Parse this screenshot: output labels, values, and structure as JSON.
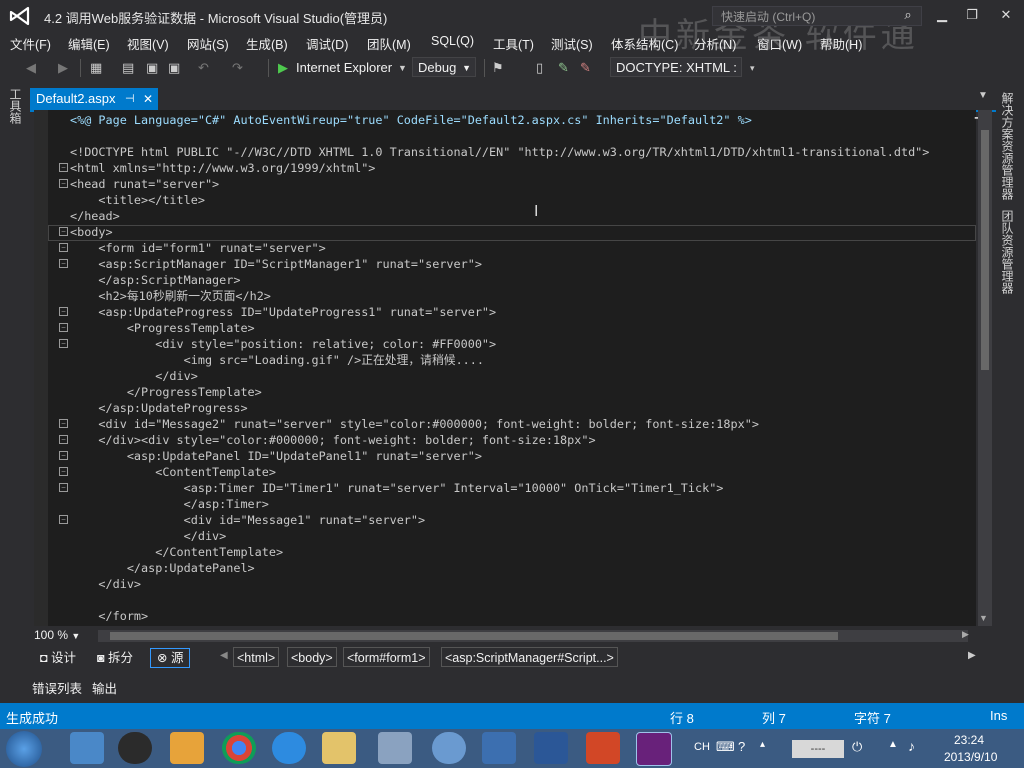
{
  "window": {
    "title": "4.2  调用Web服务验证数据 - Microsoft Visual Studio(管理员)",
    "quick_launch_placeholder": "快速启动 (Ctrl+Q)",
    "watermark": "中新金茶  软件通"
  },
  "menu": [
    "文件(F)",
    "编辑(E)",
    "视图(V)",
    "网站(S)",
    "生成(B)",
    "调试(D)",
    "团队(M)",
    "SQL(Q)",
    "工具(T)",
    "测试(S)",
    "体系结构(C)",
    "分析(N)",
    "窗口(W)",
    "帮助(H)"
  ],
  "toolbar": {
    "run_target": "Internet Explorer",
    "config": "Debug",
    "doctype": "DOCTYPE:  XHTML :"
  },
  "side": {
    "toolbox": "工具箱",
    "solution_explorer": "解决方案资源管理器",
    "team_explorer": "团队资源管理器"
  },
  "tab": {
    "name": "Default2.aspx",
    "pin": "⊣",
    "close": "✕"
  },
  "code_lines": [
    "<%@ Page Language=\"C#\" AutoEventWireup=\"true\" CodeFile=\"Default2.aspx.cs\" Inherits=\"Default2\" %>",
    "",
    "<!DOCTYPE html PUBLIC \"-//W3C//DTD XHTML 1.0 Transitional//EN\" \"http://www.w3.org/TR/xhtml1/DTD/xhtml1-transitional.dtd\">",
    "<html xmlns=\"http://www.w3.org/1999/xhtml\">",
    "<head runat=\"server\">",
    "    <title></title>",
    "</head>",
    "<body>",
    "    <form id=\"form1\" runat=\"server\">",
    "    <asp:ScriptManager ID=\"ScriptManager1\" runat=\"server\">",
    "    </asp:ScriptManager>",
    "    <h2>每10秒刷新一次页面</h2>",
    "    <asp:UpdateProgress ID=\"UpdateProgress1\" runat=\"server\">",
    "        <ProgressTemplate>",
    "            <div style=\"position: relative; color: #FF0000\">",
    "                <img src=\"Loading.gif\" />正在处理，请稍候....",
    "            </div>",
    "        </ProgressTemplate>",
    "    </asp:UpdateProgress>",
    "    <div id=\"Message2\" runat=\"server\" style=\"color:#000000; font-weight: bolder; font-size:18px\">",
    "    </div><div style=\"color:#000000; font-weight: bolder; font-size:18px\">",
    "        <asp:UpdatePanel ID=\"UpdatePanel1\" runat=\"server\">",
    "            <ContentTemplate>",
    "                <asp:Timer ID=\"Timer1\" runat=\"server\" Interval=\"10000\" OnTick=\"Timer1_Tick\">",
    "                </asp:Timer>",
    "                <div id=\"Message1\" runat=\"server\">",
    "                </div>",
    "            </ContentTemplate>",
    "        </asp:UpdatePanel>",
    "    </div>",
    "",
    "    </form>"
  ],
  "editor_footer": {
    "zoom": "100 %",
    "view_design": "设计",
    "view_split": "拆分",
    "view_source": "源",
    "breadcrumbs": [
      "<html>",
      "<body>",
      "<form#form1>",
      "<asp:ScriptManager#Script...>"
    ]
  },
  "bottom_tabs": [
    "错误列表",
    "输出"
  ],
  "status": {
    "message": "生成成功",
    "line": "行 8",
    "col": "列 7",
    "char": "字符 7",
    "mode": "Ins"
  },
  "taskbar": {
    "ime": "CH",
    "time": "23:24",
    "date": "2013/9/10",
    "input_box": "----"
  },
  "colors": {
    "accent": "#007acc",
    "editor_bg": "#1e1e1e",
    "chrome_bg": "#2d2d30"
  }
}
